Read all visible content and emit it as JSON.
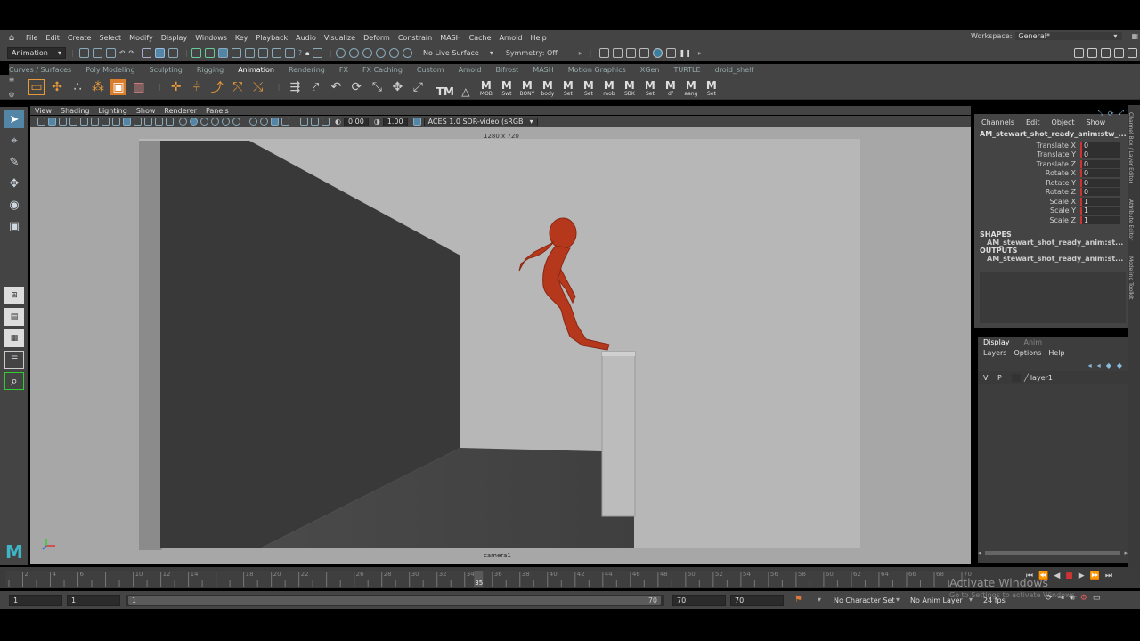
{
  "menu": {
    "items": [
      "File",
      "Edit",
      "Create",
      "Select",
      "Modify",
      "Display",
      "Windows",
      "Key",
      "Playback",
      "Audio",
      "Visualize",
      "Deform",
      "Constrain",
      "MASH",
      "Cache",
      "Arnold",
      "Help"
    ],
    "workspace_label": "Workspace:",
    "workspace_value": "General*"
  },
  "status": {
    "mode": "Animation",
    "live_surface": "No Live Surface",
    "symmetry": "Symmetry: Off"
  },
  "shelf_tabs": [
    "Curves / Surfaces",
    "Poly Modeling",
    "Sculpting",
    "Rigging",
    "Animation",
    "Rendering",
    "FX",
    "FX Caching",
    "Custom",
    "Arnold",
    "Bifrost",
    "MASH",
    "Motion Graphics",
    "XGen",
    "TURTLE",
    "droid_shelf"
  ],
  "active_shelf_tab": "Animation",
  "shelf_buttons": [
    {
      "icon": "TM",
      "label": ""
    },
    {
      "icon": "△",
      "label": ""
    },
    {
      "icon": "M",
      "label": "MOB"
    },
    {
      "icon": "M",
      "label": "Swt"
    },
    {
      "icon": "M",
      "label": "BONY"
    },
    {
      "icon": "M",
      "label": "body"
    },
    {
      "icon": "M",
      "label": "Set"
    },
    {
      "icon": "M",
      "label": "Set"
    },
    {
      "icon": "M",
      "label": "mob"
    },
    {
      "icon": "M",
      "label": "SBK"
    },
    {
      "icon": "M",
      "label": "Set"
    },
    {
      "icon": "M",
      "label": "df"
    },
    {
      "icon": "M",
      "label": "aang"
    },
    {
      "icon": "M",
      "label": "Set"
    }
  ],
  "viewport": {
    "menu": [
      "View",
      "Shading",
      "Lighting",
      "Show",
      "Renderer",
      "Panels"
    ],
    "near_value": "0.00",
    "gamma_value": "1.00",
    "color_space": "ACES 1.0 SDR-video (sRGB",
    "resolution": "1280 x 720",
    "camera": "camera1"
  },
  "channel_box": {
    "menu": [
      "Channels",
      "Edit",
      "Object",
      "Show"
    ],
    "object_name": "AM_stewart_shot_ready_anim:stw_...",
    "attributes": [
      {
        "name": "Translate X",
        "value": "0"
      },
      {
        "name": "Translate Y",
        "value": "0"
      },
      {
        "name": "Translate Z",
        "value": "0"
      },
      {
        "name": "Rotate X",
        "value": "0"
      },
      {
        "name": "Rotate Y",
        "value": "0"
      },
      {
        "name": "Rotate Z",
        "value": "0"
      },
      {
        "name": "Scale X",
        "value": "1"
      },
      {
        "name": "Scale Y",
        "value": "1"
      },
      {
        "name": "Scale Z",
        "value": "1"
      }
    ],
    "shapes_header": "SHAPES",
    "shapes_item": "AM_stewart_shot_ready_anim:st...",
    "outputs_header": "OUTPUTS",
    "outputs_item": "AM_stewart_shot_ready_anim:st..."
  },
  "side_tabs": [
    "Channel Box / Layer Editor",
    "Attribute Editor",
    "Modeling Toolkit"
  ],
  "layer_editor": {
    "tabs": [
      "Display",
      "Anim"
    ],
    "menu": [
      "Layers",
      "Options",
      "Help"
    ],
    "layer": {
      "v": "V",
      "p": "P",
      "name": "layer1"
    }
  },
  "timeline": {
    "ticks": [
      "2",
      "4",
      "6",
      "10",
      "12",
      "14",
      "18",
      "20",
      "22",
      "26",
      "28",
      "30",
      "32",
      "34",
      "36",
      "38",
      "40",
      "42",
      "44",
      "46",
      "48",
      "50",
      "52",
      "54",
      "56",
      "58",
      "60",
      "62",
      "64",
      "66",
      "68",
      "70"
    ],
    "current_frame": "35"
  },
  "range": {
    "start": "1",
    "inner_start": "1",
    "slider_start": "1",
    "slider_end": "70",
    "inner_end": "70",
    "end": "70",
    "character_set": "No Character Set",
    "anim_layer": "No Anim Layer",
    "fps": "24 fps"
  },
  "watermark": {
    "title": "Activate Windows",
    "subtitle": "Go to Settings to activate Windows."
  },
  "colors": {
    "ui_bg": "#444444",
    "viewport_bg": "#a7a7a7",
    "accent": "#5285a6",
    "character": "#b8391e",
    "keyframe": "#c8342b"
  }
}
